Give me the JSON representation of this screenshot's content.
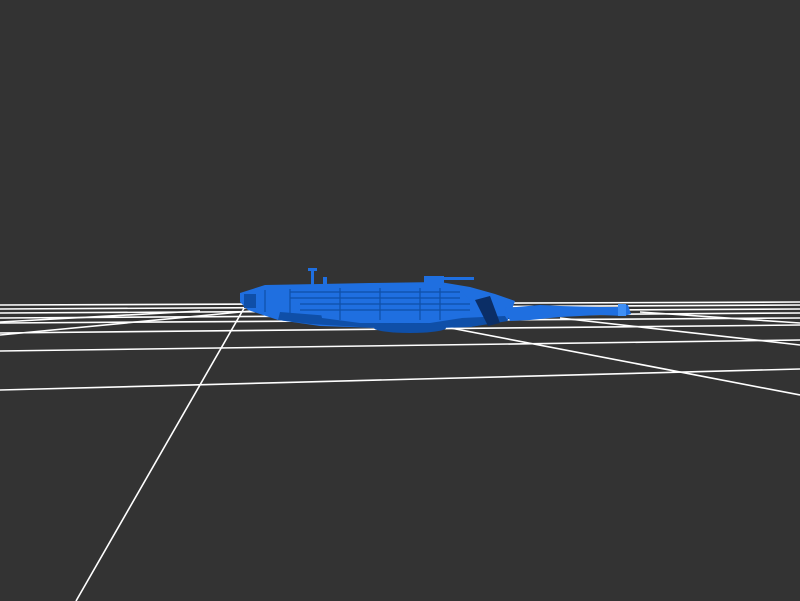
{
  "scene": {
    "background_color": "#333333",
    "grid_color": "#ffffff",
    "model_color": "#1f6fe0",
    "model_shadow_color": "#0f4fa8",
    "model_highlight_color": "#3f8ff5",
    "model_dark_color": "#0b2e66",
    "grid": true,
    "model": "tank"
  }
}
